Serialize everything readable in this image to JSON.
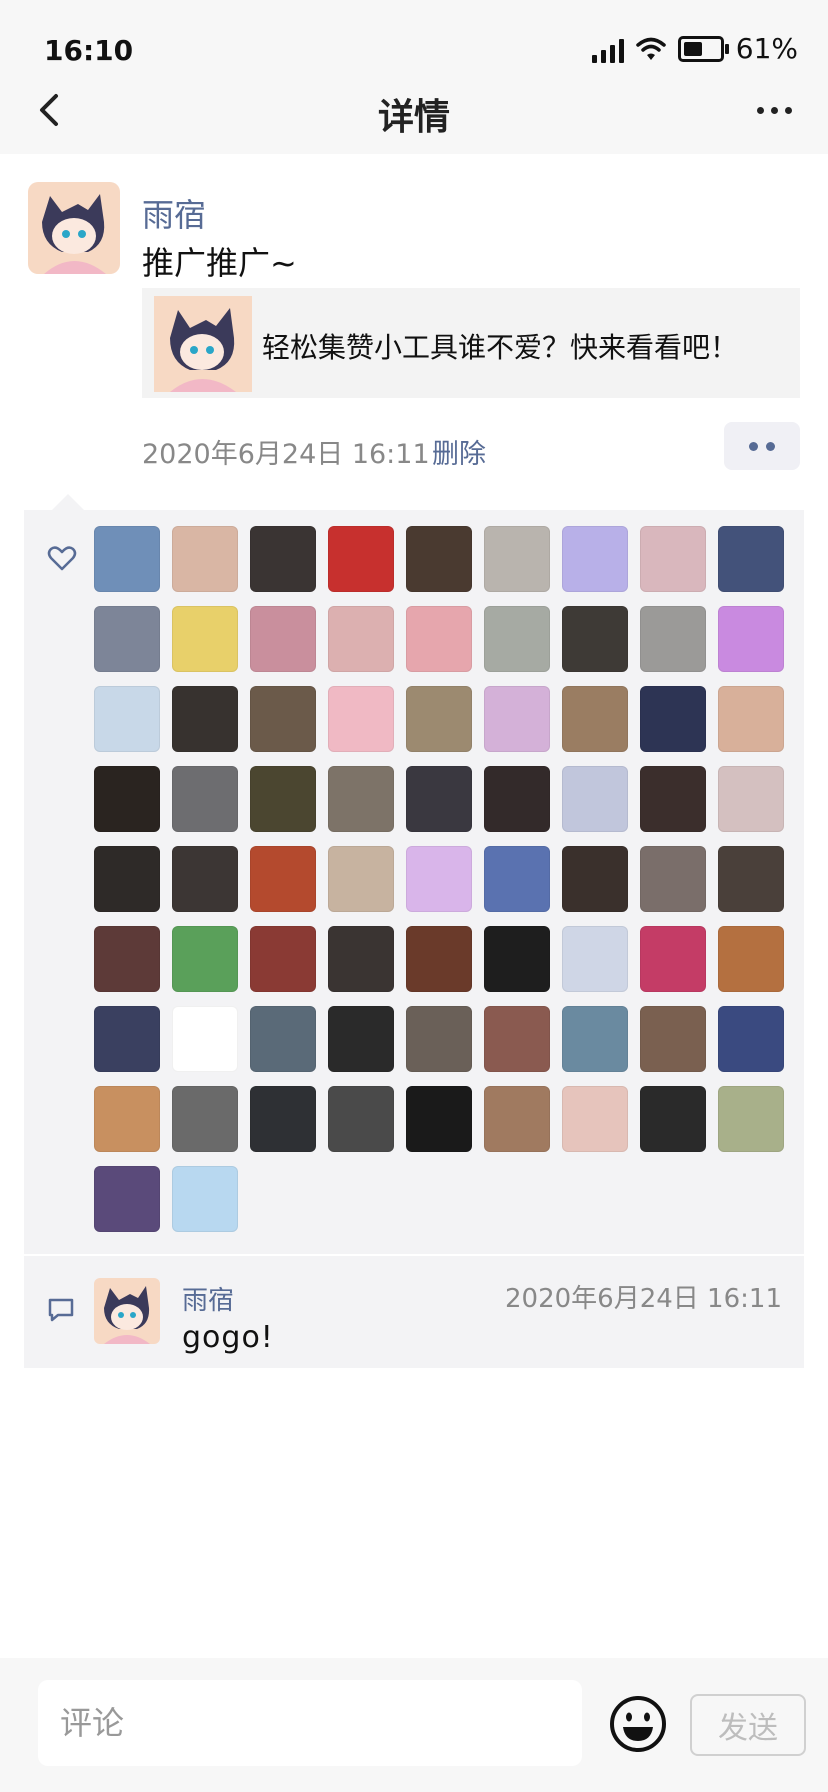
{
  "status_bar": {
    "time": "16:10",
    "battery": "61%"
  },
  "header": {
    "title": "详情",
    "back_icon": "chevron-left-icon",
    "more_icon": "more-dots-icon"
  },
  "post": {
    "author": "雨宿",
    "text": "推广推广~",
    "link_card": {
      "text": "轻松集赞小工具谁不爱？快来看看吧！"
    },
    "time": "2020年6月24日 16:11",
    "delete_label": "删除"
  },
  "likes": {
    "icon": "heart-icon",
    "avatar_colors": [
      "#6f8fb8",
      "#d9b6a4",
      "#3a3433",
      "#c7302e",
      "#4a3a30",
      "#b9b4ae",
      "#b8b0e8",
      "#d9b7bd",
      "#43527a",
      "#7d8598",
      "#e8d06a",
      "#c98f9d",
      "#dcb0b0",
      "#e6a6ad",
      "#a6aaa3",
      "#3e3a36",
      "#9b9a98",
      "#c98ae0",
      "#c8d8e8",
      "#37322f",
      "#6b5a4a",
      "#f0b9c4",
      "#9c8a70",
      "#d4b1d8",
      "#9a7d62",
      "#2d3454",
      "#d8b09a",
      "#2a2420",
      "#6d6d70",
      "#4b4630",
      "#7d7368",
      "#3a3840",
      "#332a2a",
      "#c1c6dc",
      "#3b2e2c",
      "#d4c0c0",
      "#2e2a28",
      "#3c3634",
      "#b44a2e",
      "#c7b3a0",
      "#d9b5ea",
      "#5a72b0",
      "#3a302c",
      "#7a6e6a",
      "#4a403a",
      "#5d3a38",
      "#5aa05a",
      "#8a3a34",
      "#3a3432",
      "#6a3a2a",
      "#1e1e1e",
      "#cfd6e6",
      "#c43c66",
      "#b47040",
      "#3a4060",
      "#ffffff",
      "#5a6a78",
      "#2a2a2a",
      "#6a6058",
      "#8a5a50",
      "#6a8aa0",
      "#7a6050",
      "#3a4a80",
      "#c89060",
      "#6a6a6a",
      "#2e3034",
      "#4a4a4a",
      "#1a1a1a",
      "#a07a60",
      "#e6c4bc",
      "#2a2a2a",
      "#a8b08a",
      "#5a4a7a",
      "#b8d8f0"
    ]
  },
  "comment": {
    "icon": "comment-bubble-icon",
    "author": "雨宿",
    "time": "2020年6月24日 16:11",
    "text": "gogo!"
  },
  "input_bar": {
    "placeholder": "评论",
    "send_label": "发送",
    "emoji_icon": "smiley-face-icon"
  }
}
